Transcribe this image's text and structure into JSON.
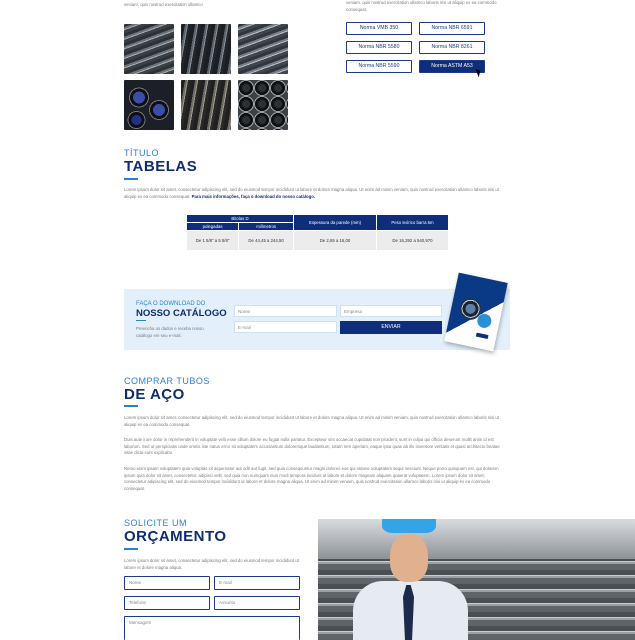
{
  "top": {
    "left_text": "veniam, quis nostrud exercitation ullamco",
    "right_text": "veniam, quis nostrud exercitation ullamco laboris nisi ut aliquip ex ea commodo consequat."
  },
  "normas": [
    "Norma VMB 350",
    "Norma NBR 6591",
    "Norma NBR 5580",
    "Norma NBR 8261",
    "Norma NBR 5590",
    "Norma ASTM A53"
  ],
  "tabelas": {
    "kicker": "TÍTULO",
    "heading": "TABELAS",
    "paragraph": "Lorem ipsum dolor sit amet, consectetur adipiscing elit, sed do eiusmod tempor incididunt ut labore et dolore magna aliqua. Ut enim ad minim veniam, quis nostrud exercitation ullamco laboris nisi ut aliquip ex ea commodo consequat.",
    "link_text": "Para mais informações, faça o download do nosso catálogo.",
    "table": {
      "group_header": "Bitolas D",
      "col_polegadas": "polegadas",
      "col_milimetros": "milímetros",
      "col_espessura": "Espessura da parede (mm)",
      "col_peso": "Peso teórico barra 6m",
      "row_polegadas": "De 1 5/8\" a 5 5/8\"",
      "row_milimetros": "De 44,45 a 244,50",
      "row_espessura": "De 2,65 a 16,00",
      "row_peso": "De 16,392 a 540,970"
    }
  },
  "catalogo": {
    "kicker": "FAÇA O DOWNLOAD DO",
    "heading": "NOSSO CATÁLOGO",
    "desc": "Preencha os dados e receba nosso catálogo em seu e-mail.",
    "nome_placeholder": "Nome",
    "empresa_placeholder": "Empresa",
    "email_placeholder": "E-mail",
    "enviar": "ENVIAR"
  },
  "comprar": {
    "kicker": "COMPRAR TUBOS",
    "heading": "DE AÇO",
    "p1": "Lorem ipsum dolor sit amet, consectetur adipiscing elit, sed do eiusmod tempor incididunt ut labore et dolore magna aliqua. Ut enim ad minim veniam, quis nostrud exercitation ullamco laboris nisi ut aliquip ex ea commodo consequat.",
    "p2": "Duis aute irure dolor in reprehenderit in voluptate velit esse cillum dolore eu fugiat nulla pariatur. Excepteur sint occaecat cupidatat non proident, sunt in culpa qui officia deserunt mollit anim id est laborum. Sed ut perspiciatis unde omnis iste natus error sit voluptatem accusantium doloremque laudantium, totam rem aperiam, eaque ipsa quae ab illo inventore veritatis et quasi architecto beatae vitae dicta sunt explicabo.",
    "p3": "Nemo enim ipsam voluptatem quia voluptas sit aspernatur aut odit aut fugit, sed quia consequuntur magni dolores eos qui ratione voluptatem sequi nesciunt. Neque porro quisquam est, qui dolorem ipsum quia dolor sit amet, consectetur, adipisci velit, sed quia non numquam eius modi tempora incidunt ut labore et dolore magnam aliquam quaerat voluptatem. Lorem ipsum dolor sit amet, consectetur adipiscing elit, sed do eiusmod tempor incididunt ut labore et dolore magna aliqua. Ut enim ad minim veniam, quis nostrud exercitation ullamco laboris nisi ut aliquip ex ea commodo consequat."
  },
  "orcamento": {
    "kicker": "SOLICITE UM",
    "heading": "ORÇAMENTO",
    "desc": "Lorem ipsum dolor sit amet, consectetur adipiscing elit, sed do eiusmod tempor incididunt ut labore et dolore magna aliqua.",
    "nome": "Nome",
    "email": "E-mail",
    "telefone": "Telefone",
    "assunto": "Assunto",
    "mensagem": "Mensagem"
  }
}
